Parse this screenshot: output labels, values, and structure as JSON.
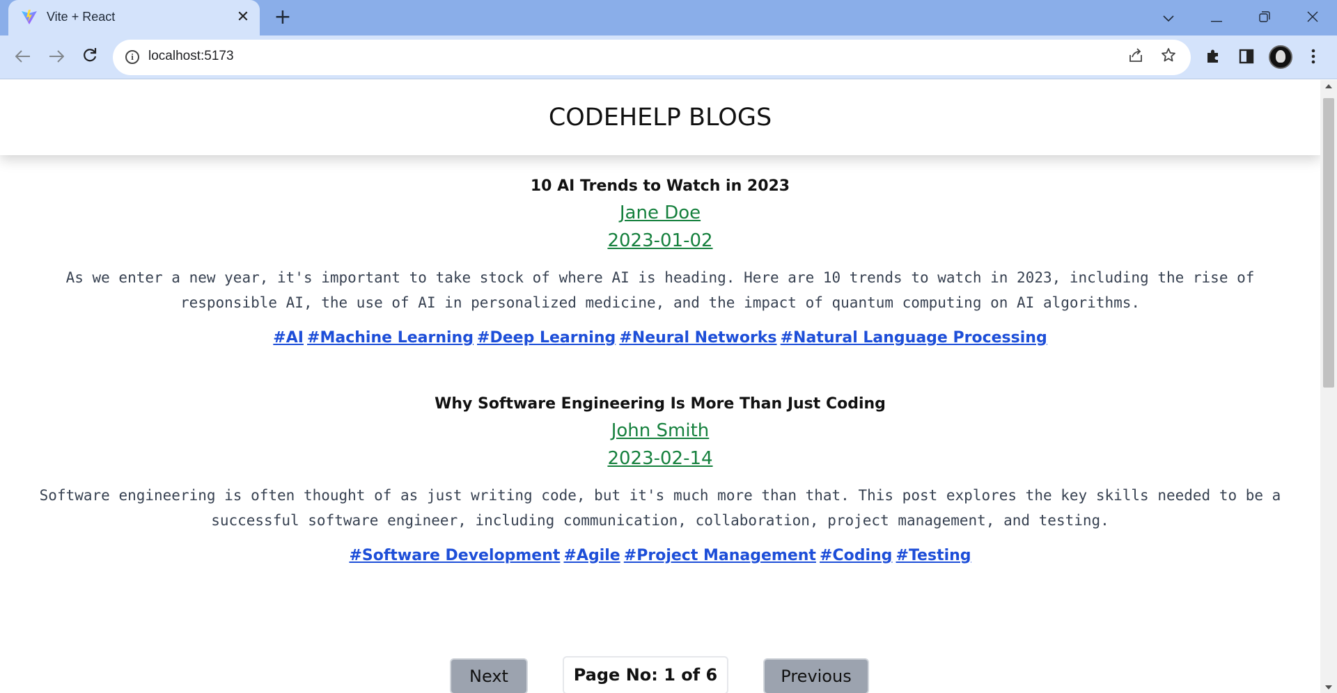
{
  "browser": {
    "tab_title": "Vite + React",
    "url": "localhost:5173"
  },
  "page": {
    "header_title": "CODEHELP BLOGS",
    "posts": [
      {
        "title": "10 AI Trends to Watch in 2023",
        "author": "Jane Doe",
        "date": "2023-01-02",
        "content": "As we enter a new year, it's important to take stock of where AI is heading. Here are 10 trends to watch in 2023, including the rise of responsible AI, the use of AI in personalized medicine, and the impact of quantum computing on AI algorithms.",
        "tags": [
          "#AI",
          "#Machine Learning",
          "#Deep Learning",
          "#Neural Networks",
          "#Natural Language Processing"
        ]
      },
      {
        "title": "Why Software Engineering Is More Than Just Coding",
        "author": "John Smith",
        "date": "2023-02-14",
        "content": "Software engineering is often thought of as just writing code, but it's much more than that. This post explores the key skills needed to be a successful software engineer, including communication, collaboration, project management, and testing.",
        "tags": [
          "#Software Development",
          "#Agile",
          "#Project Management",
          "#Coding",
          "#Testing"
        ]
      }
    ],
    "pagination": {
      "next_label": "Next",
      "page_info": "Page No: 1 of 6",
      "previous_label": "Previous"
    }
  },
  "colors": {
    "author_link": "#15803d",
    "tag_link": "#1d4ed8",
    "button_bg": "#9ca3af",
    "tabstrip": "#8aaee9",
    "toolbar": "#d4e3fb"
  },
  "icons": [
    "vite-icon",
    "close-icon",
    "plus-icon",
    "chevron-down-icon",
    "minimize-icon",
    "restore-icon",
    "back-icon",
    "forward-icon",
    "reload-icon",
    "info-icon",
    "share-icon",
    "star-icon",
    "extensions-icon",
    "side-panel-icon",
    "profile-avatar",
    "menu-icon"
  ]
}
